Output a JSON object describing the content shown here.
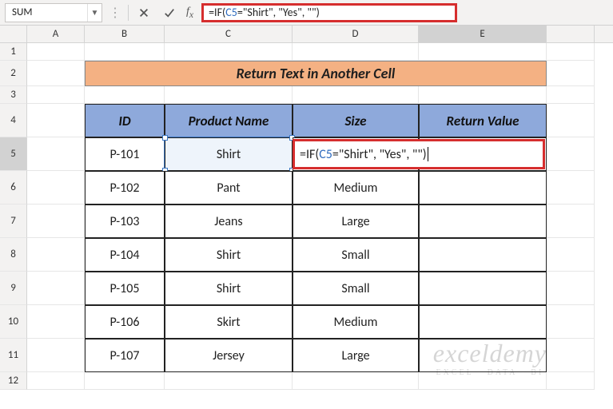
{
  "namebox": {
    "value": "SUM"
  },
  "formula_bar": {
    "prefix": "=IF(",
    "ref": "C5",
    "suffix": "=\"Shirt\", \"Yes\", \"\")"
  },
  "columns": [
    "A",
    "B",
    "C",
    "D",
    "E"
  ],
  "active_col": "E",
  "active_row": "5",
  "rows": [
    "1",
    "2",
    "3",
    "4",
    "5",
    "6",
    "7",
    "8",
    "9",
    "10",
    "11",
    "12"
  ],
  "title": "Return Text in Another Cell",
  "headers": {
    "id": "ID",
    "product": "Product Name",
    "size": "Size",
    "retval": "Return Value"
  },
  "data": [
    {
      "id": "P-101",
      "product": "Shirt",
      "size": ""
    },
    {
      "id": "P-102",
      "product": "Pant",
      "size": "Medium"
    },
    {
      "id": "P-103",
      "product": "Jeans",
      "size": "Large"
    },
    {
      "id": "P-104",
      "product": "Shirt",
      "size": "Small"
    },
    {
      "id": "P-105",
      "product": "Shirt",
      "size": "Small"
    },
    {
      "id": "P-106",
      "product": "Skirt",
      "size": "Medium"
    },
    {
      "id": "P-107",
      "product": "Jersey",
      "size": "Large"
    }
  ],
  "cell_formula": {
    "prefix": "=IF(",
    "ref": "C5",
    "suffix": "=\"Shirt\", \"Yes\", \"\")"
  },
  "watermark": {
    "line1": "exceldemy",
    "line2": "EXCEL · DATA · BI"
  }
}
